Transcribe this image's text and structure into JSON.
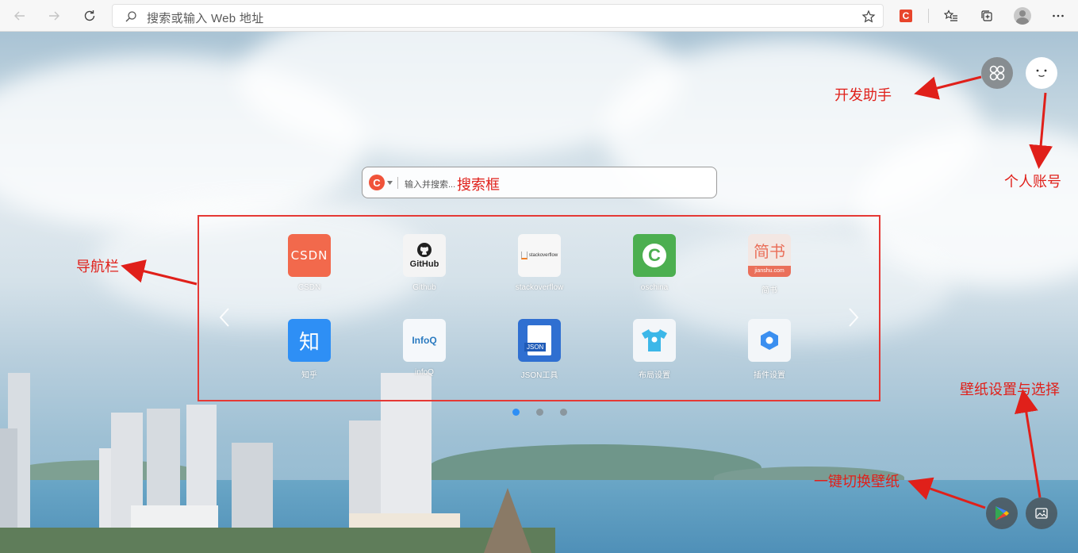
{
  "browser": {
    "address_placeholder": "搜索或输入 Web 地址",
    "icons": [
      "back-icon",
      "forward-icon",
      "refresh-icon",
      "search-icon",
      "favorite-star-icon",
      "csdn-extension-icon",
      "favorites-list-icon",
      "collections-icon",
      "profile-icon",
      "more-icon"
    ]
  },
  "search": {
    "engine_logo": "C",
    "placeholder": "输入并搜索..."
  },
  "nav": {
    "items": [
      {
        "label": "CSDN",
        "icon_text": "CSDN",
        "color": "#f2694c"
      },
      {
        "label": "Github",
        "icon_text": "GitHub",
        "color": "#f4f4f4"
      },
      {
        "label": "stackoverflow",
        "icon_text": "stackoverflow",
        "color": "#f7f7f7"
      },
      {
        "label": "oschina",
        "icon_text": "C",
        "color": "#4caf50"
      },
      {
        "label": "简书",
        "icon_text": "简书",
        "icon_subtext": "jianshu.com",
        "color": "#f3e7e3"
      },
      {
        "label": "知乎",
        "icon_text": "知",
        "color": "#2e8ff5"
      },
      {
        "label": "infoQ",
        "icon_text": "InfoQ",
        "color": "#f5f8fb"
      },
      {
        "label": "JSON工具",
        "icon_text": "JSON",
        "color": "#2f6fd1"
      },
      {
        "label": "布局设置",
        "icon_text": "shirt",
        "color": "#f3f6f9"
      },
      {
        "label": "插件设置",
        "icon_text": "hex",
        "color": "#f3f6f9"
      }
    ],
    "prev_icon": "chevron-left-icon",
    "next_icon": "chevron-right-icon",
    "pages": 3,
    "active_page": 1,
    "dot_active_color": "#2e8ff5"
  },
  "annotations": {
    "dev_helper": "开发助手",
    "account": "个人账号",
    "search_box": "搜索框",
    "navbar": "导航栏",
    "wallpaper_settings": "壁纸设置与选择",
    "switch_wallpaper": "一键切换壁纸",
    "color": "#e0201a"
  }
}
